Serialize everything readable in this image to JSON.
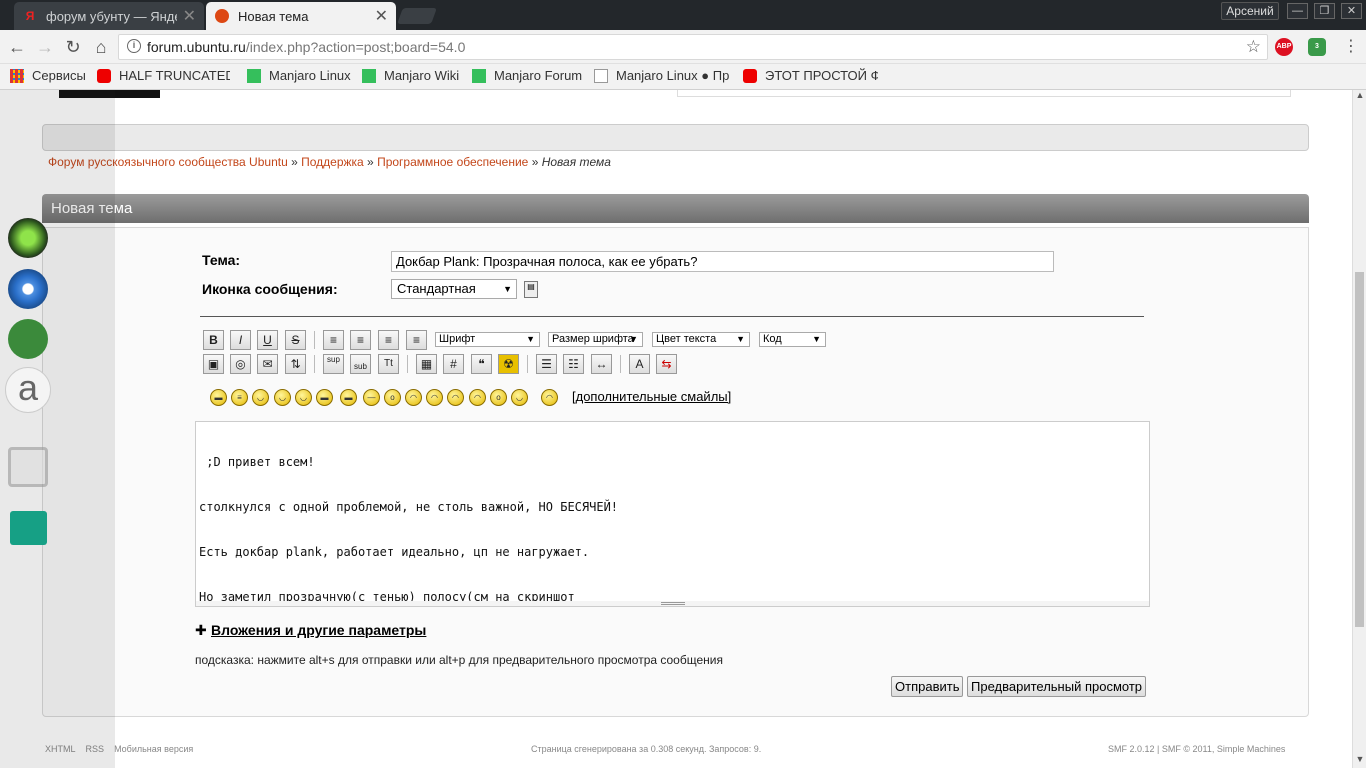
{
  "browser": {
    "tabs": [
      {
        "label": "форум убунту — Яндекс",
        "icon": "yandex-icon"
      },
      {
        "label": "Новая тема",
        "icon": "ubuntu-icon"
      }
    ],
    "user": "Арсений",
    "url_host": "forum.ubuntu.ru",
    "url_path": "/index.php?action=post;board=54.0",
    "extensions": [
      {
        "name": "ABP",
        "icon": "adblock-icon"
      },
      {
        "name": "3",
        "icon": "shield-icon"
      }
    ],
    "bookmarks": [
      {
        "label": "Сервисы",
        "icon": "apps-icon"
      },
      {
        "label": "HALF TRUNCATED",
        "icon": "youtube-icon"
      },
      {
        "label": "Manjaro Linux",
        "icon": "manjaro-icon"
      },
      {
        "label": "Manjaro Wiki",
        "icon": "manjaro-icon"
      },
      {
        "label": "Manjaro Forum",
        "icon": "manjaro-icon"
      },
      {
        "label": "Manjaro Linux ● Пр",
        "icon": "page-icon"
      },
      {
        "label": "ЭТОТ ПРОСТОЙ Ф",
        "icon": "youtube-icon"
      }
    ]
  },
  "breadcrumb": [
    {
      "label": "Форум русскоязычного сообщества Ubuntu"
    },
    {
      "label": "Поддержка"
    },
    {
      "label": "Программное обеспечение"
    },
    {
      "label": "Новая тема"
    }
  ],
  "form": {
    "title": "Новая тема",
    "subject_label": "Тема:",
    "subject_value": "Докбар Plank: Прозрачная полоса, как ее убрать?",
    "icon_label": "Иконка сообщения:",
    "icon_value": "Стандартная",
    "selects": {
      "font": "Шрифт",
      "size": "Размер шрифта",
      "color": "Цвет текста",
      "code": "Код"
    },
    "more_smileys": "[дополнительные смайлы]",
    "message_lines": [
      " ;D привет всем!",
      "столкнулся с одной проблемой, не столь важной, НО БЕСЯЧЕЙ!",
      "Есть докбар plank, работает идеально, цп не нагружает.",
      "Но заметил прозрачную(с тенью) полосу(см на скриншот"
    ],
    "attachments_label": "Вложения и другие параметры",
    "hint": "подсказка: нажмите alt+s для отправки или alt+p для предварительного просмотра сообщения",
    "submit_label": "Отправить",
    "preview_label": "Предварительный просмотр"
  },
  "footer": {
    "links": [
      "XHTML",
      "RSS",
      "Мобильная версия"
    ],
    "generated": "Страница сгенерирована за 0.308 секунд. Запросов: 9.",
    "smf": "SMF 2.0.12 | SMF © 2011, Simple Machines"
  },
  "colors": {
    "link": "#c3471b",
    "header_bar": "#7c7c7c"
  }
}
